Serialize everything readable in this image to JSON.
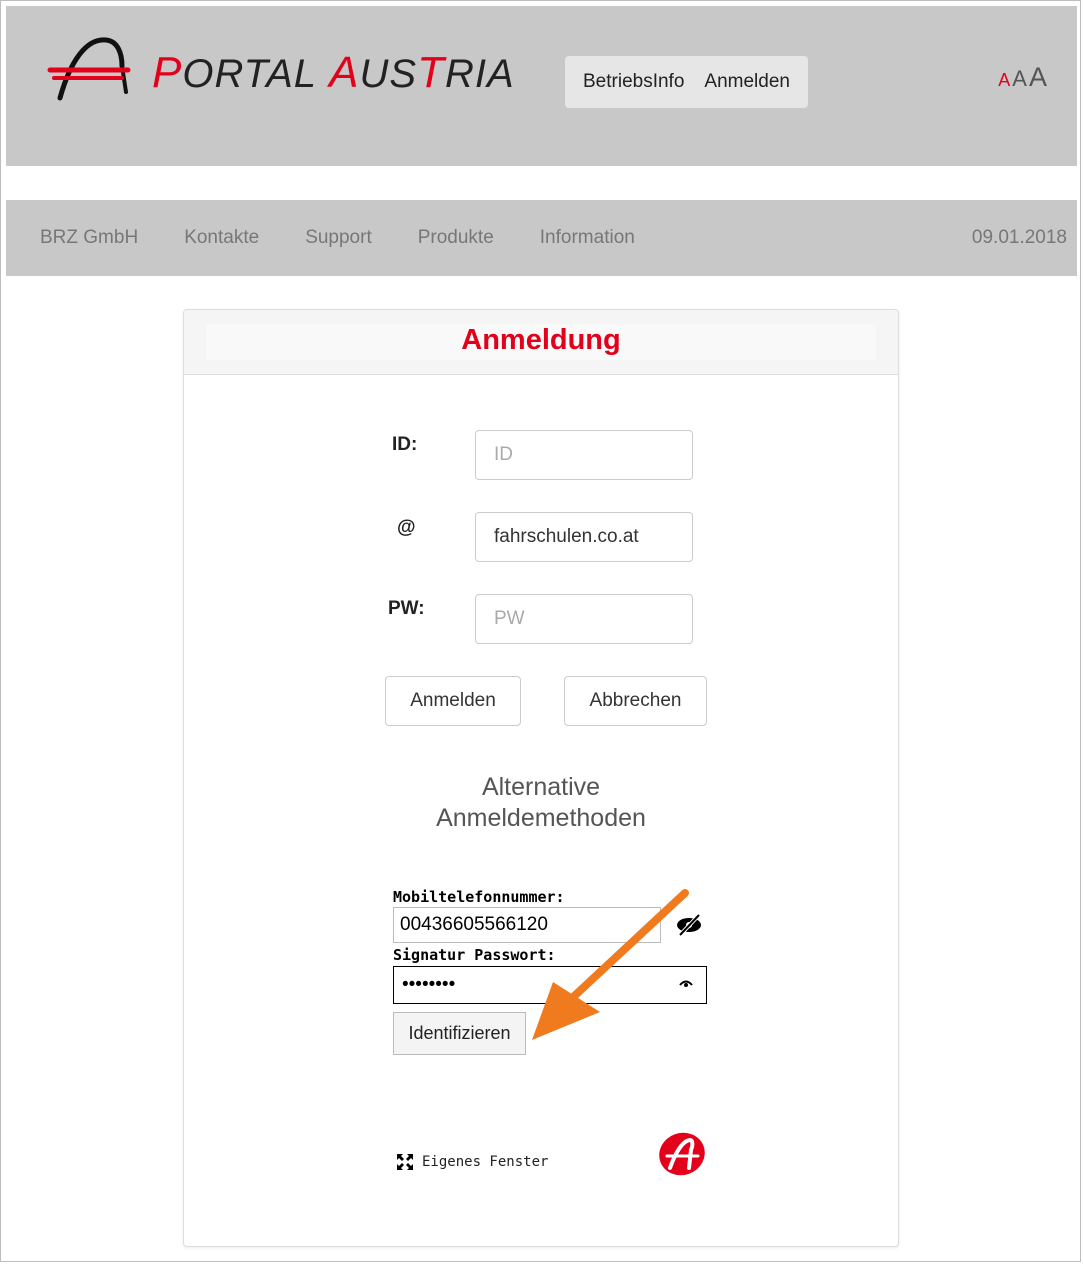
{
  "header": {
    "logo": {
      "first_letter": "P",
      "first_rest": "ORTAL",
      "second_letter": "A",
      "second_mid": "US",
      "second_t": "T",
      "second_rest": "RIA"
    },
    "nav": [
      "BetriebsInfo",
      "Anmelden"
    ],
    "font_size_controls": [
      "A",
      "A",
      "A"
    ]
  },
  "subnav": {
    "links": [
      "BRZ GmbH",
      "Kontakte",
      "Support",
      "Produkte",
      "Information"
    ],
    "date": "09.01.2018"
  },
  "login": {
    "title": "Anmeldung",
    "id_label": "ID:",
    "id_placeholder": "ID",
    "domain_label": "@",
    "domain_value": "fahrschulen.co.at",
    "pw_label": "PW:",
    "pw_placeholder": "PW",
    "submit": "Anmelden",
    "cancel": "Abbrechen"
  },
  "alt": {
    "title_line1": "Alternative",
    "title_line2": "Anmeldemethoden",
    "phone_label": "Mobiltelefonnummer:",
    "phone_value": "00436605566120",
    "sig_label": "Signatur Passwort:",
    "sig_value": "••••••••",
    "identify": "Identifizieren",
    "own_window": "Eigenes Fenster"
  },
  "colors": {
    "accent": "#e2001a",
    "header_bg": "#c8c8c8",
    "arrow": "#f07a1e"
  },
  "icons": [
    "eye-slash-icon",
    "eye-icon",
    "expand-icon",
    "a-trust-logo",
    "arrow-annotation"
  ]
}
